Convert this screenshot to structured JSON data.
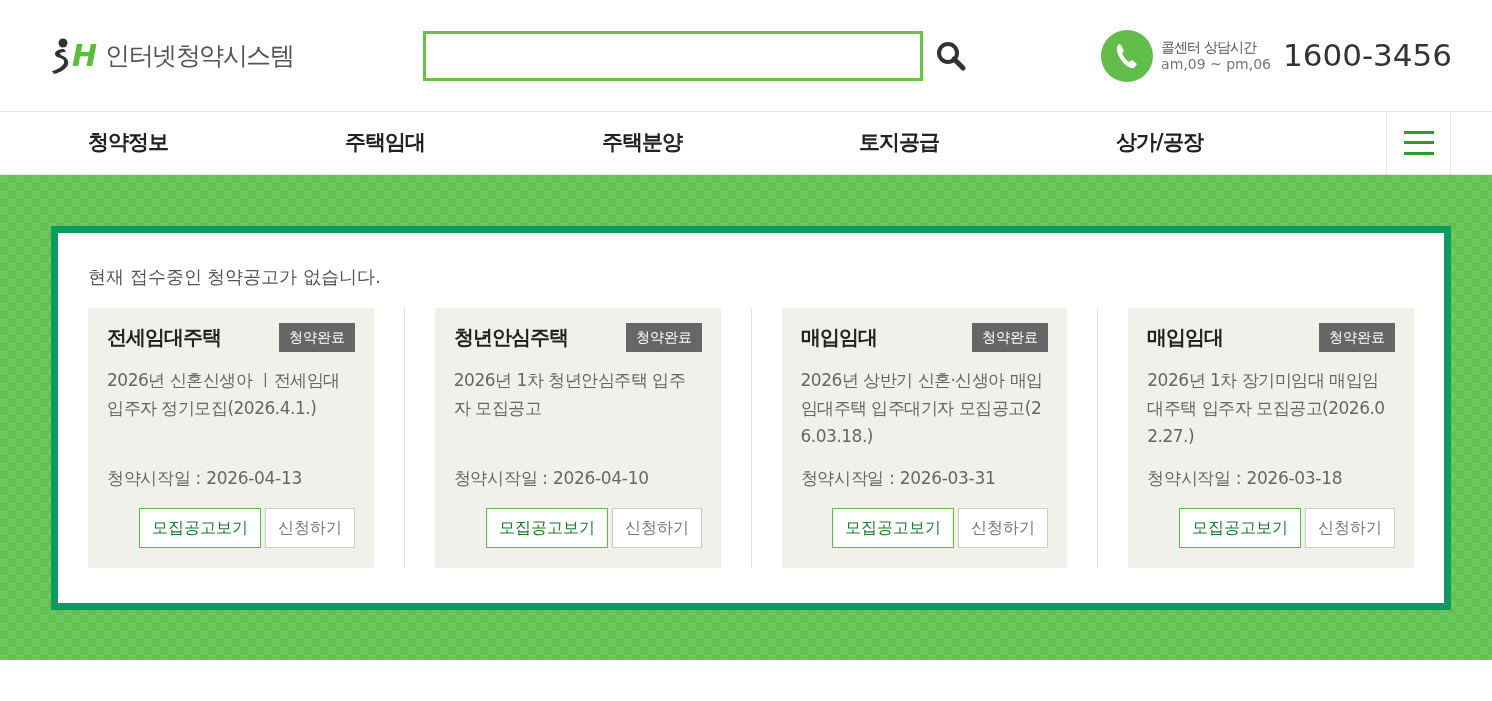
{
  "header": {
    "logo_mark": "H",
    "logo_text": "인터넷청약시스템",
    "call_center": {
      "label": "콜센터 상담시간",
      "hours": "am,09 ~ pm,06",
      "phone": "1600-3456"
    }
  },
  "nav": {
    "items": [
      {
        "label": "청약정보"
      },
      {
        "label": "주택임대"
      },
      {
        "label": "주택분양"
      },
      {
        "label": "토지공급"
      },
      {
        "label": "상가/공장"
      }
    ]
  },
  "notice": "현재 접수중인 청약공고가 없습니다.",
  "cards": [
    {
      "category": "전세임대주택",
      "status": "청약완료",
      "title": "2026년 신혼신생아 ㅣ전세임대 입주자 정기모집(2026.4.1.)",
      "start": "청약시작일 : 2026-04-13",
      "buttons": [
        "모집공고보기",
        "신청하기"
      ]
    },
    {
      "category": "청년안심주택",
      "status": "청약완료",
      "title": "2026년 1차 청년안심주택 입주자 모집공고",
      "start": "청약시작일 : 2026-04-10",
      "buttons": [
        "모집공고보기",
        "신청하기"
      ]
    },
    {
      "category": "매입임대",
      "status": "청약완료",
      "title": "2026년 상반기 신혼·신생아 매입임대주택 입주대기자 모집공고(26.03.18.)",
      "start": "청약시작일 : 2026-03-31",
      "buttons": [
        "모집공고보기",
        "신청하기"
      ]
    },
    {
      "category": "매입임대",
      "status": "청약완료",
      "title": "2026년 1차 장기미임대 매입임대주택 입주자 모집공고(2026.02.27.)",
      "start": "청약시작일 : 2026-03-18",
      "buttons": [
        "모집공고보기",
        "신청하기"
      ]
    }
  ]
}
